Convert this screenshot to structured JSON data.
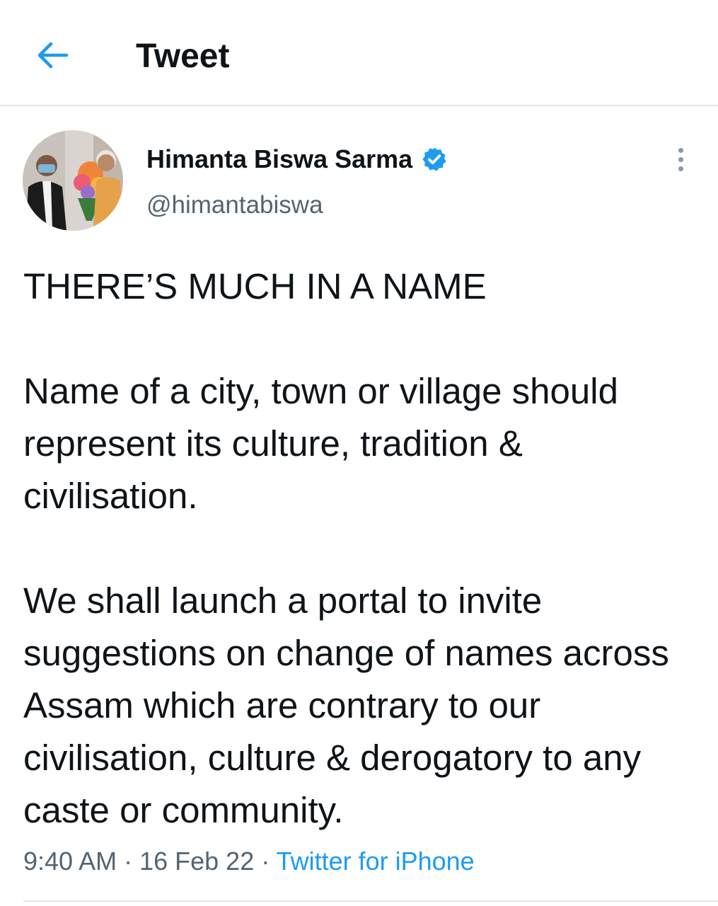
{
  "header": {
    "title": "Tweet",
    "back_icon": "arrow-left-icon",
    "accent_color": "#1d9bf0"
  },
  "tweet": {
    "author": {
      "name": "Himanta Biswa Sarma",
      "handle": "@himantabiswa",
      "verified_icon": "verified-badge-icon"
    },
    "paragraphs": [
      "THERE’S MUCH IN A NAME",
      "Name of a city, town or village should represent its culture, tradition & civilisation.",
      "We shall launch a portal to invite suggestions on change of names across Assam which are contrary to our civilisation, culture & derogatory to any caste or community."
    ],
    "time": "9:40 AM",
    "separator": " · ",
    "date": "16 Feb 22",
    "source": "Twitter for iPhone"
  }
}
